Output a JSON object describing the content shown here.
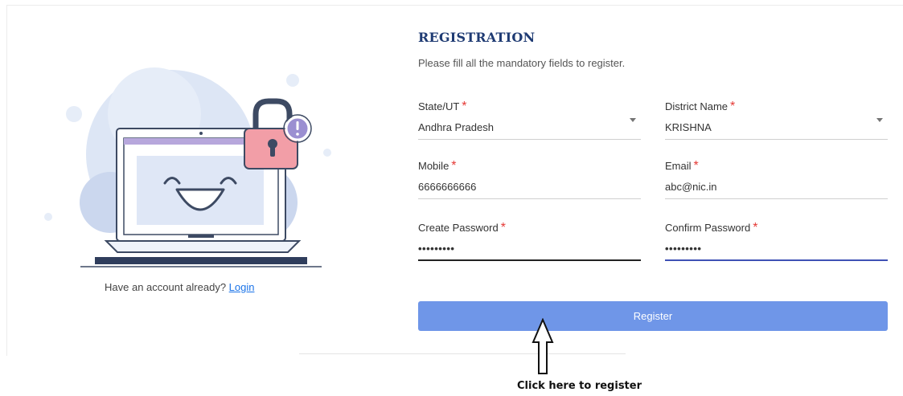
{
  "register": {
    "title": "REGISTRATION",
    "subtitle": "Please fill all the mandatory fields to register.",
    "fields": {
      "state": {
        "label": "State/UT",
        "required_mark": "*",
        "value": "Andhra Pradesh"
      },
      "district": {
        "label": "District Name",
        "required_mark": "*",
        "value": "KRISHNA"
      },
      "mobile": {
        "label": "Mobile",
        "required_mark": "*",
        "value": "6666666666"
      },
      "email": {
        "label": "Email",
        "required_mark": "*",
        "value": "abc@nic.in"
      },
      "create_password": {
        "label": "Create Password",
        "required_mark": "*",
        "value": "•••••••••"
      },
      "confirm_password": {
        "label": "Confirm Password",
        "required_mark": "*",
        "value": "•••••••••"
      }
    },
    "button_label": "Register"
  },
  "login_prompt": {
    "text": "Have an account already?",
    "link": "Login"
  },
  "annotation": {
    "text": "Click here to register"
  },
  "colors": {
    "title": "#1f3b73",
    "button": "#6f96e8",
    "required": "#e53935",
    "focus_line": "#3f51b5",
    "lock": "#f29ea7",
    "badge": "#9b8fd1"
  },
  "icons": {
    "illustration": "laptop-lock-illustration",
    "dropdown": "caret-down-icon",
    "annotation": "up-arrow-icon"
  }
}
